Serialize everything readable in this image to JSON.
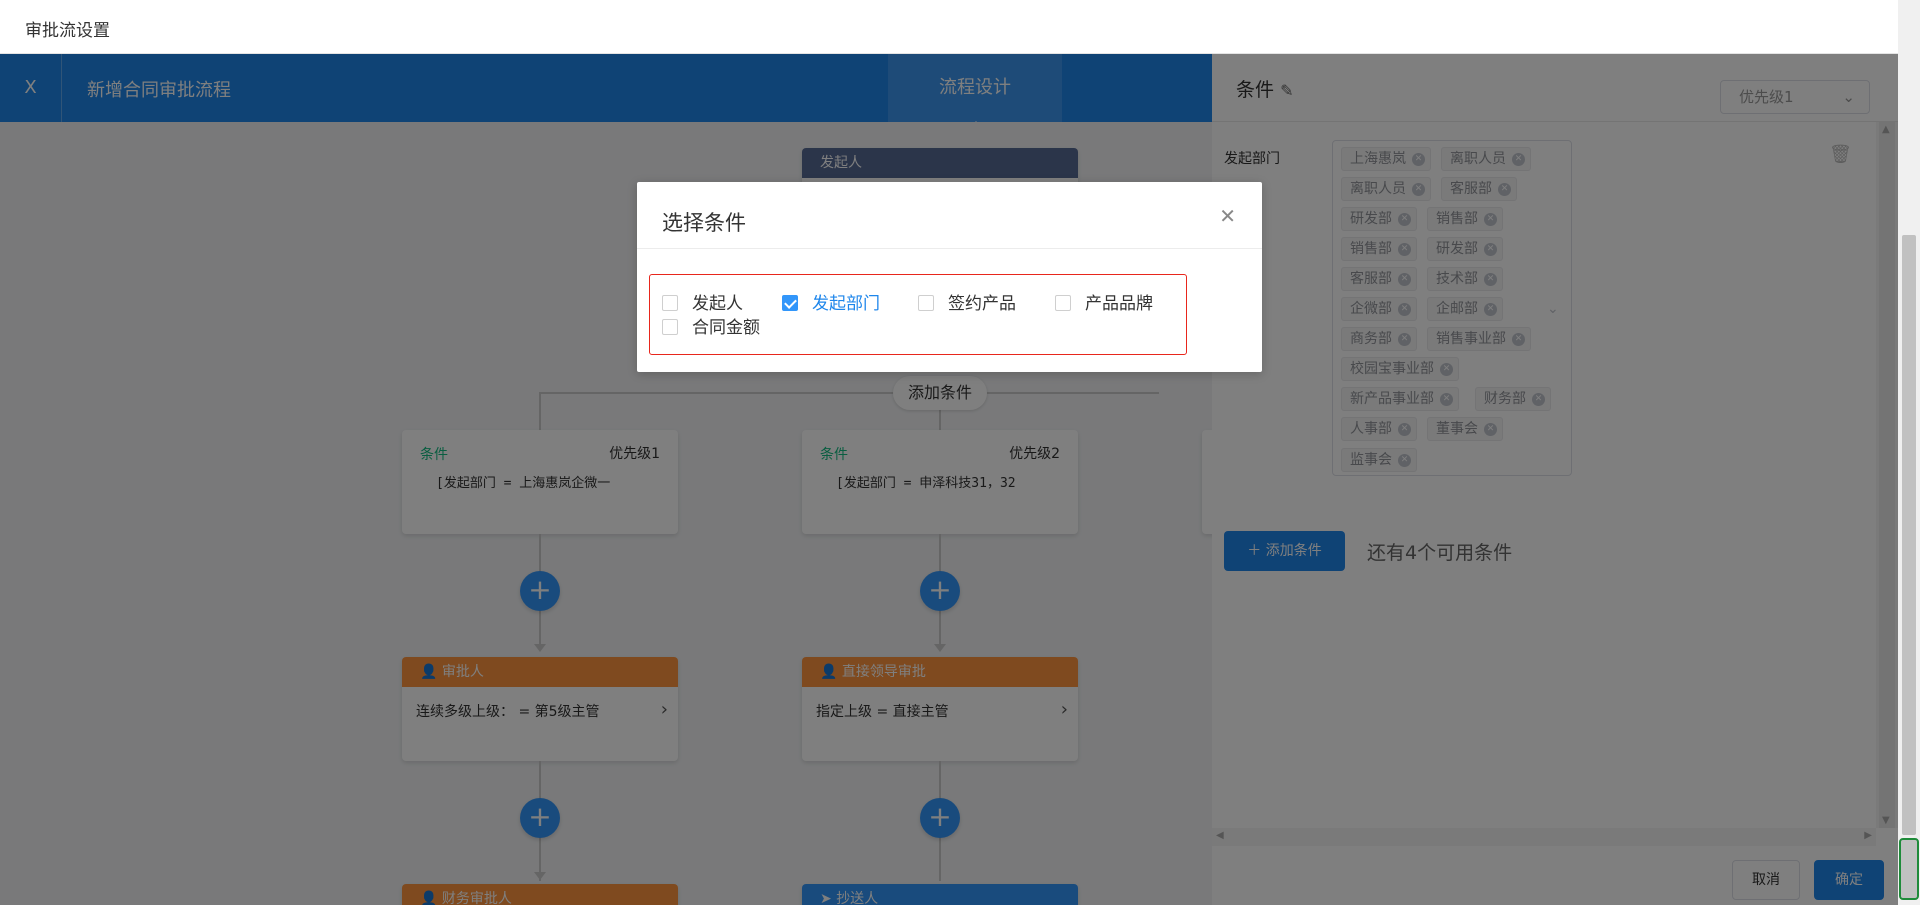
{
  "window": {
    "title": "审批流设置"
  },
  "header": {
    "close": "X",
    "title": "新增合同审批流程",
    "tab": "流程设计"
  },
  "canvas": {
    "initiator_label": "发起人",
    "add_condition": "添加条件",
    "plus": "+",
    "conditions": [
      {
        "label": "条件",
        "priority": "优先级1",
        "content": "[发起部门 = 上海惠岚企微一"
      },
      {
        "label": "条件",
        "priority": "优先级2",
        "content": "[发起部门 = 申泽科技31，32"
      }
    ],
    "approvers": [
      {
        "title": "审批人",
        "content": "连续多级上级： = 第5级主管"
      },
      {
        "title": "直接领导审批",
        "content": "指定上级 = 直接主管"
      }
    ],
    "bottom_nodes": [
      {
        "title": "财务审批人"
      },
      {
        "title": "抄送人"
      }
    ]
  },
  "drawer": {
    "title": "条件",
    "priority_select": "优先级1",
    "field_label": "发起部门",
    "tags": [
      "上海惠岚",
      "离职人员",
      "离职人员",
      "客服部",
      "研发部",
      "销售部",
      "销售部",
      "研发部",
      "客服部",
      "技术部",
      "企微部",
      "企邮部",
      "商务部",
      "销售事业部",
      "校园宝事业部",
      "新产品事业部",
      "财务部",
      "人事部",
      "董事会",
      "监事会"
    ],
    "add_button": "添加条件",
    "remaining": "还有4个可用条件",
    "cancel": "取消",
    "confirm": "确定"
  },
  "modal": {
    "title": "选择条件",
    "options": [
      {
        "label": "发起人",
        "checked": false
      },
      {
        "label": "发起部门",
        "checked": true
      },
      {
        "label": "签约产品",
        "checked": false
      },
      {
        "label": "产品品牌",
        "checked": false
      },
      {
        "label": "合同金额",
        "checked": false
      }
    ]
  },
  "colors": {
    "primary": "#1e86eb",
    "approver": "#ff943e",
    "initiator": "#576a95",
    "condition": "#15bc83",
    "highlight_border": "#e8261c"
  }
}
